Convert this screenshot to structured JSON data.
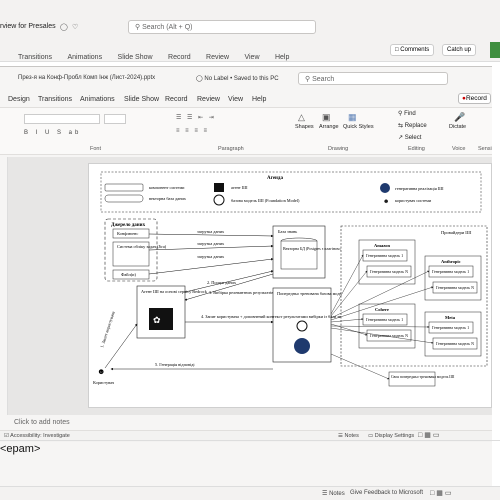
{
  "outer": {
    "title": "rview for Presales",
    "search_placeholder": "Search (Alt + Q)",
    "menu": [
      "Transitions",
      "Animations",
      "Slide Show",
      "Record",
      "Review",
      "View",
      "Help"
    ],
    "comments": "Comments",
    "catch_up": "Catch up"
  },
  "ppt": {
    "filename": "През-я на Конф-Пробл Комп Інж (Лист-2024).pptx",
    "label": "No Label • Saved to this PC",
    "search_placeholder": "Search",
    "record_btn": "Record",
    "tabs": [
      "Design",
      "Transitions",
      "Animations",
      "Slide Show",
      "Record",
      "Review",
      "View",
      "Help"
    ],
    "groups": {
      "font": "Font",
      "paragraph": "Paragraph",
      "drawing": "Drawing",
      "editing": "Editing",
      "voice": "Voice",
      "sensitivity": "Sensi"
    },
    "ribbon": {
      "shapes": "Shapes",
      "arrange": "Arrange",
      "quick_styles": "Quick Styles",
      "find": "Find",
      "replace": "Replace",
      "select": "Select",
      "dictate": "Dictate"
    },
    "notes_placeholder": "Click to add notes",
    "accessibility": "Accessibility: Investigate",
    "notes_btn": "Notes",
    "display_settings": "Display Settings"
  },
  "footer": {
    "notes": "Notes",
    "feedback": "Give Feedback to Microsoft",
    "logo": "<epam>"
  },
  "slide": {
    "legend": {
      "title": "Агенда",
      "system_component": "компонент системи",
      "vector_db": "векторна база даних",
      "ai_agent": "агент ШІ",
      "foundation": "базова модель ШІ (Foundation Model)",
      "gen_impl": "генеративна реалізація ШІ",
      "user": "користувач системи"
    },
    "sources": {
      "title": "Джерело даних",
      "confluence": "Конфлюенс",
      "tracker": "Система обліку задач (Jira)",
      "files": "Файл(и)"
    },
    "agent": "Агент ШІ на основі сервісу Bedrock",
    "kb": "База знань",
    "vector_db": "Векторна БД (Postgres з плагіном pgvector)",
    "pretrained": "Попередньо тренована базова модель ШІ (з лист. Foundation Model)",
    "providers": "Провайдери ШІ",
    "amazon": "Amazon",
    "anthropic": "Anthropic",
    "cohere": "Cohere",
    "meta": "Meta",
    "gen_model_1": "Генеративна модель 1",
    "gen_model_n": "Генеративна модель N",
    "own_model": "Своя попередньо тренована модель ШІ",
    "user": "Користувач",
    "arrows": {
      "load1": "загрузка даних",
      "load2": "загрузка даних",
      "load3": "загрузка даних",
      "search": "2. Пошук даних",
      "select": "3. Вибірка релевантних результатів",
      "request": "4. Запит користувача + доповнений контекст результатами вибірки із бази знань",
      "query": "1. Запит користувача",
      "answer": "5. Генерація відповіді"
    }
  }
}
